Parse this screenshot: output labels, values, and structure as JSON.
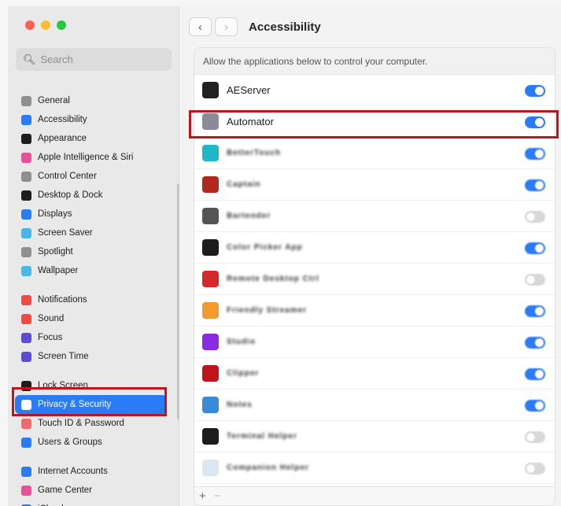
{
  "window": {
    "controls": [
      "close",
      "minimize",
      "zoom"
    ]
  },
  "search": {
    "placeholder": "Search",
    "value": ""
  },
  "sidebar": {
    "groups": [
      [
        {
          "label": "General",
          "icon": "gear-icon",
          "color": "#8e8e93"
        },
        {
          "label": "Accessibility",
          "icon": "accessibility-icon",
          "color": "#2a7bf6"
        },
        {
          "label": "Appearance",
          "icon": "appearance-icon",
          "color": "#1d1d1f"
        },
        {
          "label": "Apple Intelligence & Siri",
          "icon": "siri-icon",
          "color": "#e8509a"
        },
        {
          "label": "Control Center",
          "icon": "control-center-icon",
          "color": "#8e8e93"
        },
        {
          "label": "Desktop & Dock",
          "icon": "dock-icon",
          "color": "#1d1d1f"
        },
        {
          "label": "Displays",
          "icon": "sun-icon",
          "color": "#2a7bf6"
        },
        {
          "label": "Screen Saver",
          "icon": "screen-saver-icon",
          "color": "#47b6e6"
        },
        {
          "label": "Spotlight",
          "icon": "spotlight-icon",
          "color": "#8e8e93"
        },
        {
          "label": "Wallpaper",
          "icon": "wallpaper-icon",
          "color": "#4cb8e8"
        }
      ],
      [
        {
          "label": "Notifications",
          "icon": "bell-icon",
          "color": "#f04a43"
        },
        {
          "label": "Sound",
          "icon": "speaker-icon",
          "color": "#f04a43"
        },
        {
          "label": "Focus",
          "icon": "moon-icon",
          "color": "#5b4bd6"
        },
        {
          "label": "Screen Time",
          "icon": "hourglass-icon",
          "color": "#5b4bd6"
        }
      ],
      [
        {
          "label": "Lock Screen",
          "icon": "lock-icon",
          "color": "#1d1d1f"
        },
        {
          "label": "Privacy & Security",
          "icon": "hand-icon",
          "color": "#2a7bf6",
          "selected": true
        },
        {
          "label": "Touch ID & Password",
          "icon": "fingerprint-icon",
          "color": "#f06a6a"
        },
        {
          "label": "Users & Groups",
          "icon": "users-icon",
          "color": "#2a7bf6"
        }
      ],
      [
        {
          "label": "Internet Accounts",
          "icon": "at-icon",
          "color": "#2a7bf6"
        },
        {
          "label": "Game Center",
          "icon": "game-center-icon",
          "color": "#e8509a"
        },
        {
          "label": "iCloud",
          "icon": "cloud-icon",
          "color": "#2a7bf6"
        }
      ]
    ]
  },
  "toolbar": {
    "back": "‹",
    "forward": "›",
    "title": "Accessibility"
  },
  "panel": {
    "header": "Allow the applications below to control your computer.",
    "apps": [
      {
        "name": "AEServer",
        "icon_color": "#222222",
        "on": true,
        "blurred": false
      },
      {
        "name": "Automator",
        "icon_color": "#8a8a9a",
        "on": true,
        "blurred": false
      },
      {
        "name": "BetterTouch",
        "icon_color": "#1fb8c9",
        "on": true,
        "blurred": true
      },
      {
        "name": "Captain",
        "icon_color": "#b0281e",
        "on": true,
        "blurred": true
      },
      {
        "name": "Bartender",
        "icon_color": "#555555",
        "on": false,
        "blurred": true
      },
      {
        "name": "Color Picker App",
        "icon_color": "#1d1d1f",
        "on": true,
        "blurred": true
      },
      {
        "name": "Remote Desktop Ctrl",
        "icon_color": "#d62828",
        "on": false,
        "blurred": true
      },
      {
        "name": "Friendly Streamer",
        "icon_color": "#f29a2e",
        "on": true,
        "blurred": true
      },
      {
        "name": "Studio",
        "icon_color": "#8a2be2",
        "on": true,
        "blurred": true
      },
      {
        "name": "Clipper",
        "icon_color": "#c0141c",
        "on": true,
        "blurred": true
      },
      {
        "name": "Notes",
        "icon_color": "#3a8bd6",
        "on": true,
        "blurred": true
      },
      {
        "name": "Terminal Helper",
        "icon_color": "#1d1d1f",
        "on": false,
        "blurred": true
      },
      {
        "name": "Companion Helper",
        "icon_color": "#dbe8f2",
        "on": false,
        "blurred": true
      }
    ]
  },
  "footer": {
    "add": "+",
    "remove": "−"
  }
}
